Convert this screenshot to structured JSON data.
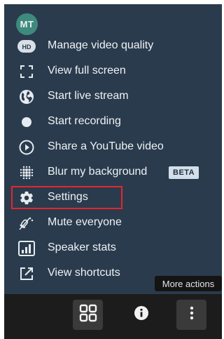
{
  "avatar": {
    "initials": "MT"
  },
  "menu": {
    "items": [
      {
        "label": "Manage video quality",
        "icon": "hd-icon"
      },
      {
        "label": "View full screen",
        "icon": "fullscreen-icon"
      },
      {
        "label": "Start live stream",
        "icon": "globe-icon"
      },
      {
        "label": "Start recording",
        "icon": "record-icon"
      },
      {
        "label": "Share a YouTube video",
        "icon": "play-circle-icon"
      },
      {
        "label": "Blur my background",
        "icon": "blur-icon",
        "badge": "BETA"
      },
      {
        "label": "Settings",
        "icon": "gear-icon",
        "highlighted": true
      },
      {
        "label": "Mute everyone",
        "icon": "mute-everyone-icon"
      },
      {
        "label": "Speaker stats",
        "icon": "stats-icon"
      },
      {
        "label": "View shortcuts",
        "icon": "external-link-icon"
      }
    ]
  },
  "tooltip": {
    "text": "More actions"
  },
  "toolbar": {
    "buttons": [
      {
        "icon": "tile-view-icon"
      },
      {
        "icon": "info-icon"
      },
      {
        "icon": "more-actions-icon"
      }
    ]
  },
  "colors": {
    "menu_bg": "#2a3b4d",
    "toolbar_bg": "#1c1c1c",
    "highlight_border": "#e3262f",
    "avatar_bg": "#3f8a7e",
    "badge_bg": "#d2dee9"
  }
}
